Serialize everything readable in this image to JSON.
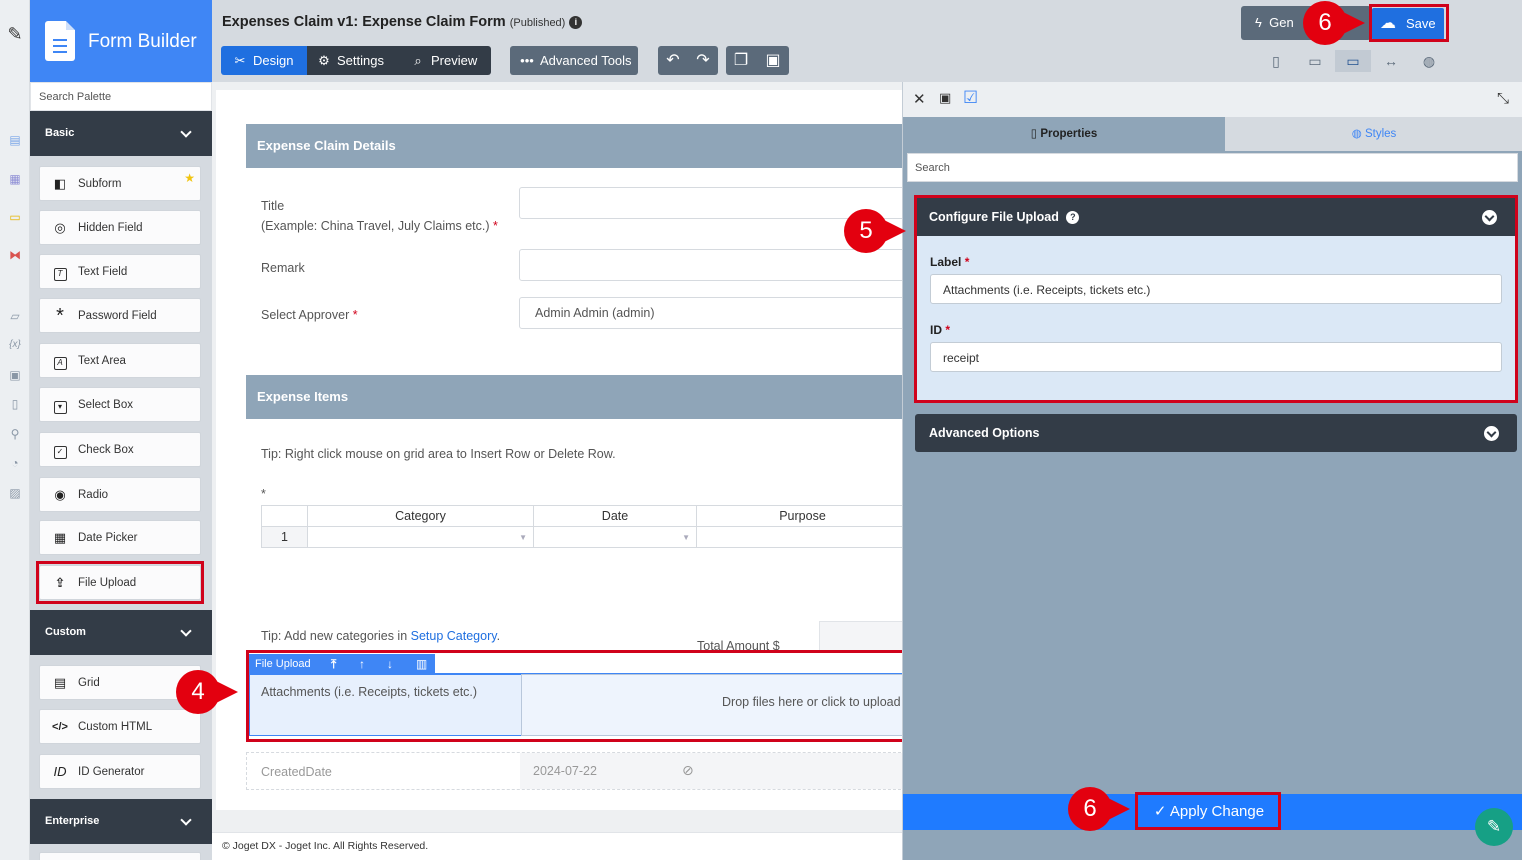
{
  "brand": {
    "title": "Form Builder"
  },
  "palette": {
    "search_placeholder": "Search Palette",
    "sections": [
      {
        "label": "Basic"
      },
      {
        "label": "Custom"
      },
      {
        "label": "Enterprise"
      }
    ],
    "basic_items": [
      {
        "label": "Subform",
        "icon": "subform-icon"
      },
      {
        "label": "Hidden Field",
        "icon": "eye-slash-icon"
      },
      {
        "label": "Text Field",
        "icon": "text-field-icon"
      },
      {
        "label": "Password Field",
        "icon": "asterisk-icon"
      },
      {
        "label": "Text Area",
        "icon": "text-area-icon"
      },
      {
        "label": "Select Box",
        "icon": "select-box-icon"
      },
      {
        "label": "Check Box",
        "icon": "check-box-icon"
      },
      {
        "label": "Radio",
        "icon": "radio-icon"
      },
      {
        "label": "Date Picker",
        "icon": "calendar-icon"
      },
      {
        "label": "File Upload",
        "icon": "upload-icon"
      }
    ],
    "custom_items": [
      {
        "label": "Grid",
        "icon": "grid-icon"
      },
      {
        "label": "Custom HTML",
        "icon": "code-icon"
      },
      {
        "label": "ID Generator",
        "icon": "id-icon"
      }
    ]
  },
  "header": {
    "title": "Expenses Claim v1: Expense Claim Form",
    "status": "(Published)",
    "tabs": {
      "design": "Design",
      "settings": "Settings",
      "preview": "Preview"
    },
    "advanced_tools": "Advanced Tools",
    "generate": "Gen",
    "save": "Save"
  },
  "form": {
    "section1_title": "Expense Claim Details",
    "title_label": "Title",
    "title_hint": "(Example: China Travel, July Claims etc.)",
    "remark_label": "Remark",
    "approver_label": "Select Approver",
    "approver_value": "Admin Admin (admin)",
    "section2_title": "Expense Items",
    "tip1": "Tip: Right click mouse on grid area to Insert Row or Delete Row.",
    "grid_columns": [
      "Category",
      "Date",
      "Purpose"
    ],
    "grid_row_number": "1",
    "tip2_prefix": "Tip: Add new categories in ",
    "tip2_link": "Setup Category",
    "tip2_suffix": ".",
    "total_label": "Total Amount $",
    "file_upload_bar": "File Upload",
    "attachments_label": "Attachments (i.e. Receipts, tickets etc.)",
    "drop_text": "Drop files here or click to upload",
    "created_label": "CreatedDate",
    "created_value": "2024-07-22"
  },
  "footer": {
    "text": "© Joget DX - Joget Inc. All Rights Reserved."
  },
  "properties": {
    "tab_properties": "Properties",
    "tab_styles": "Styles",
    "search_placeholder": "Search",
    "config_title": "Configure File Upload",
    "label_field": "Label",
    "label_value": "Attachments (i.e. Receipts, tickets etc.)",
    "id_field": "ID",
    "id_value": "receipt",
    "advanced_options": "Advanced Options",
    "apply": "Apply Change"
  },
  "markers": {
    "m4": "4",
    "m5": "5",
    "m6a": "6",
    "m6b": "6"
  },
  "colors": {
    "accent": "#1f6fe0",
    "dark": "#333c47",
    "highlight": "#d0021b",
    "marker": "#e3000f"
  }
}
